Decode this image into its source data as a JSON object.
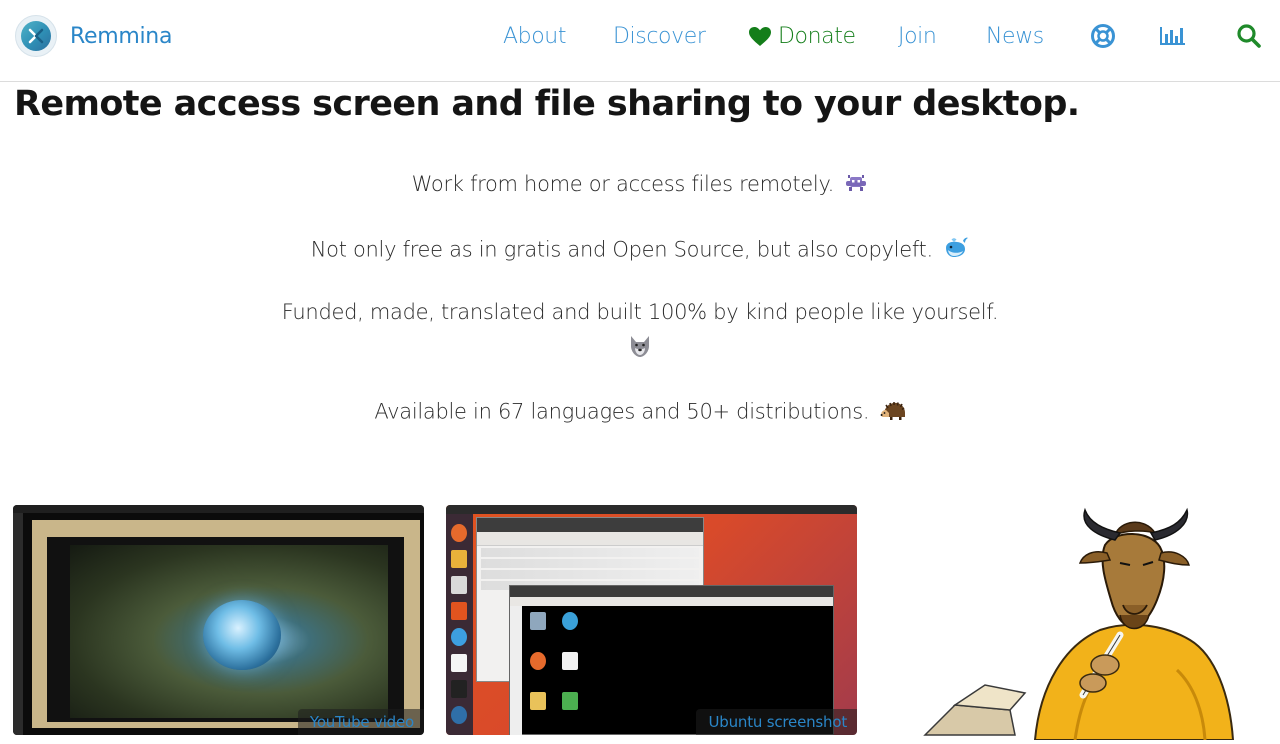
{
  "header": {
    "brand_name": "Remmina",
    "nav": {
      "about": "About",
      "discover": "Discover",
      "donate": "Donate",
      "join": "Join",
      "news": "News"
    },
    "icons": [
      "help-icon",
      "stats-icon",
      "search-icon"
    ],
    "colors": {
      "link": "#3a93d4",
      "donate": "#147e1a"
    }
  },
  "hero": {
    "headline": "Remote access screen and file sharing to your desktop.",
    "taglines": [
      "Work from home or access files remotely.",
      "Not only free as in gratis and Open Source, but also copyleft.",
      "Funded, made, translated and built 100% by kind people like yourself.",
      "Available in 67 languages and 50+ distributions."
    ],
    "emoji_icons": [
      "space-invader-icon",
      "whale-icon",
      "wolf-icon",
      "hedgehog-icon"
    ]
  },
  "media": {
    "youtube_caption": "YouTube video",
    "ubuntu_caption": "Ubuntu screenshot"
  }
}
